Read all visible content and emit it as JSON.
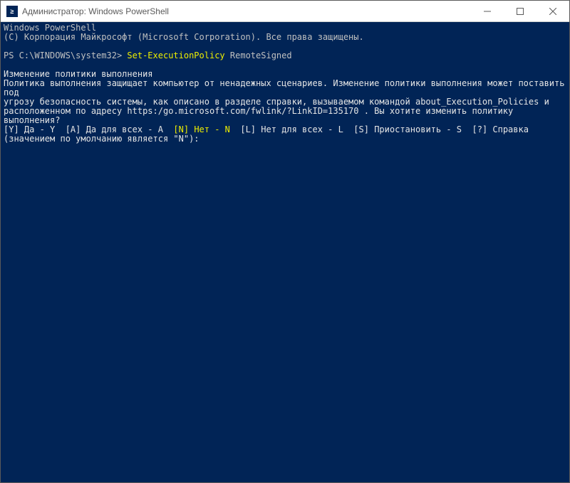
{
  "titlebar": {
    "icon_label": "≥",
    "title": "Администратор: Windows PowerShell"
  },
  "console": {
    "line1": "Windows PowerShell",
    "line2": "(C) Корпорация Майкрософт (Microsoft Corporation). Все права защищены.",
    "blank": "",
    "prompt_prefix": "PS C:\\WINDOWS\\system32> ",
    "cmd": "Set-ExecutionPolicy ",
    "cmd_arg": "RemoteSigned",
    "heading": "Изменение политики выполнения",
    "body1": "Политика выполнения защищает компьютер от ненадежных сценариев. Изменение политики выполнения может поставить под",
    "body2": "угрозу безопасность системы, как описано в разделе справки, вызываемом командой about_Execution_Policies и",
    "body3": "расположенном по адресу https:/go.microsoft.com/fwlink/?LinkID=135170 . Вы хотите изменить политику выполнения?",
    "opt1": "[Y] Да - Y  ",
    "opt2": "[A] Да для всех - A  ",
    "opt3_hl": "[N] Нет - N  ",
    "opt4": "[L] Нет для всех - L  ",
    "opt5": "[S] Приостановить - S  ",
    "opt6": "[?] Справка",
    "default_line": "(значением по умолчанию является \"N\"):"
  }
}
